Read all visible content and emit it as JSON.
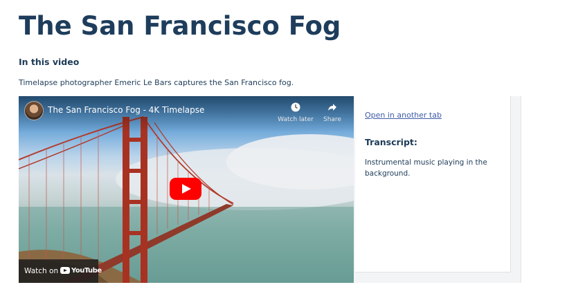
{
  "page": {
    "title": "The San Francisco Fog",
    "section_heading": "In this video",
    "intro": "Timelapse photographer Emeric Le Bars captures the San Francisco fog."
  },
  "video": {
    "title": "The San Francisco Fog - 4K Timelapse",
    "watch_later_label": "Watch later",
    "share_label": "Share",
    "watch_on_label": "Watch on",
    "youtube_label": "YouTube",
    "play_color": "#ff0000"
  },
  "side_panel": {
    "open_link": "Open in another tab",
    "transcript_heading": "Transcript:",
    "transcript_text": "Instrumental music playing in the background."
  },
  "icons": [
    "clock-icon",
    "share-icon",
    "play-icon",
    "youtube-logo-icon"
  ],
  "colors": {
    "title": "#1e3d5c",
    "link": "#3d5ba8"
  }
}
